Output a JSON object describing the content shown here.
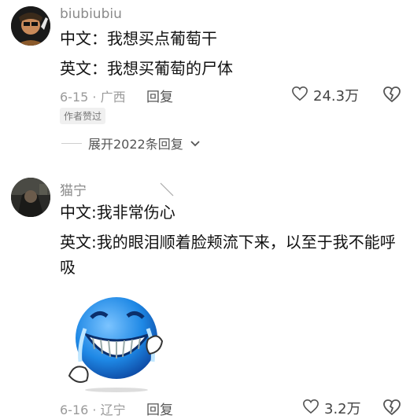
{
  "comments": [
    {
      "username": "biubiubiu",
      "lines": [
        "中文：我想买点葡萄干",
        "英文：我想买葡萄的尸体"
      ],
      "meta": "6-15 · 广西",
      "reply_label": "回复",
      "likes": "24.3万",
      "badge": "作者赞过",
      "expand_label": "展开2022条回复"
    },
    {
      "username": "猫宁",
      "lines": [
        "中文:我非常伤心",
        "英文:我的眼泪顺着脸颊流下来，以至于我不能呼",
        "吸"
      ],
      "meta": "6-16 · 辽宁",
      "reply_label": "回复",
      "likes": "3.2万",
      "sticker": "crying-laughing-emoji"
    }
  ],
  "colors": {
    "sticker_blue": "#1e88e5",
    "meta_gray": "#9a9a9a"
  },
  "icons": [
    "heart-icon",
    "broken-heart-icon",
    "chevron-down-icon"
  ]
}
